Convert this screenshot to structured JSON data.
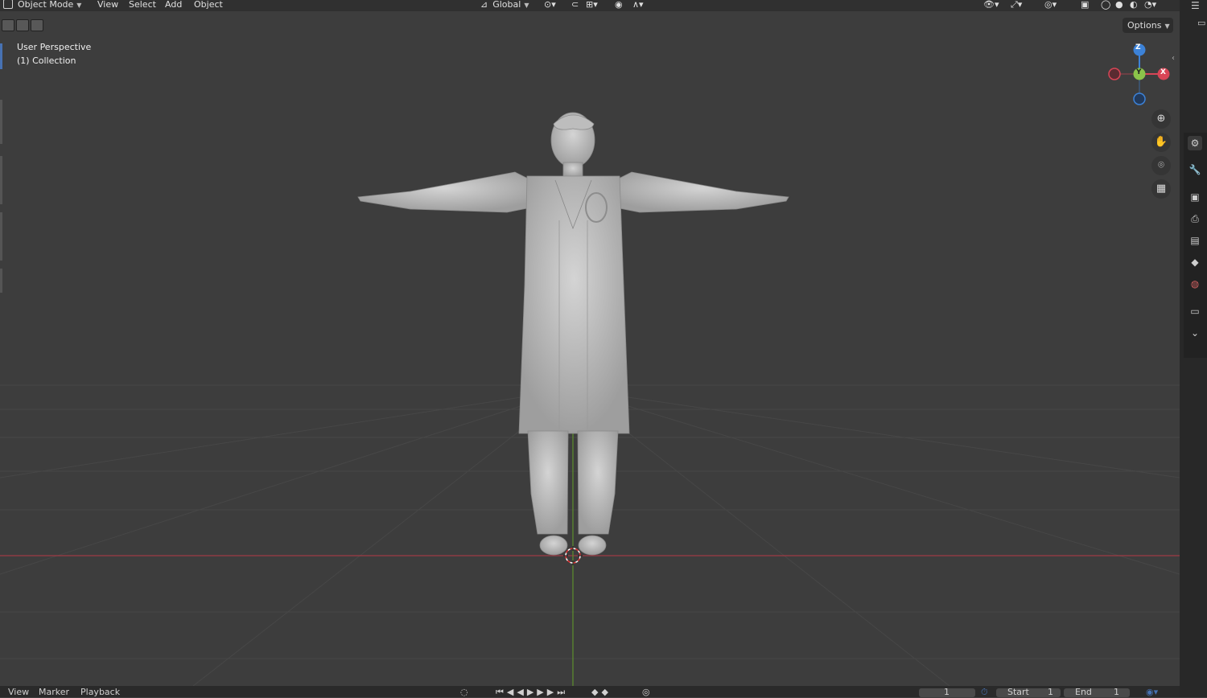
{
  "header": {
    "mode": "Object Mode",
    "menus": [
      "View",
      "Select",
      "Add",
      "Object"
    ],
    "orientation": "Global"
  },
  "viewport": {
    "perspective_label": "User Perspective",
    "collection_label": "(1) Collection",
    "options_label": "Options",
    "gizmo": {
      "z": "Z",
      "y": "Y",
      "x": "X"
    }
  },
  "timeline": {
    "menus": [
      "View",
      "Marker",
      "Playback"
    ],
    "current_frame": "1",
    "start_label": "Start",
    "start_value": "1",
    "end_label": "End",
    "end_value": "1"
  },
  "colors": {
    "x_axis": "#d84556",
    "y_axis": "#8bc34a",
    "z_axis": "#3c82d8",
    "accent": "#4772b3"
  },
  "icons": {
    "zoom": "zoom-icon",
    "pan": "hand-icon",
    "camera": "camera-icon",
    "ortho": "grid-icon"
  }
}
